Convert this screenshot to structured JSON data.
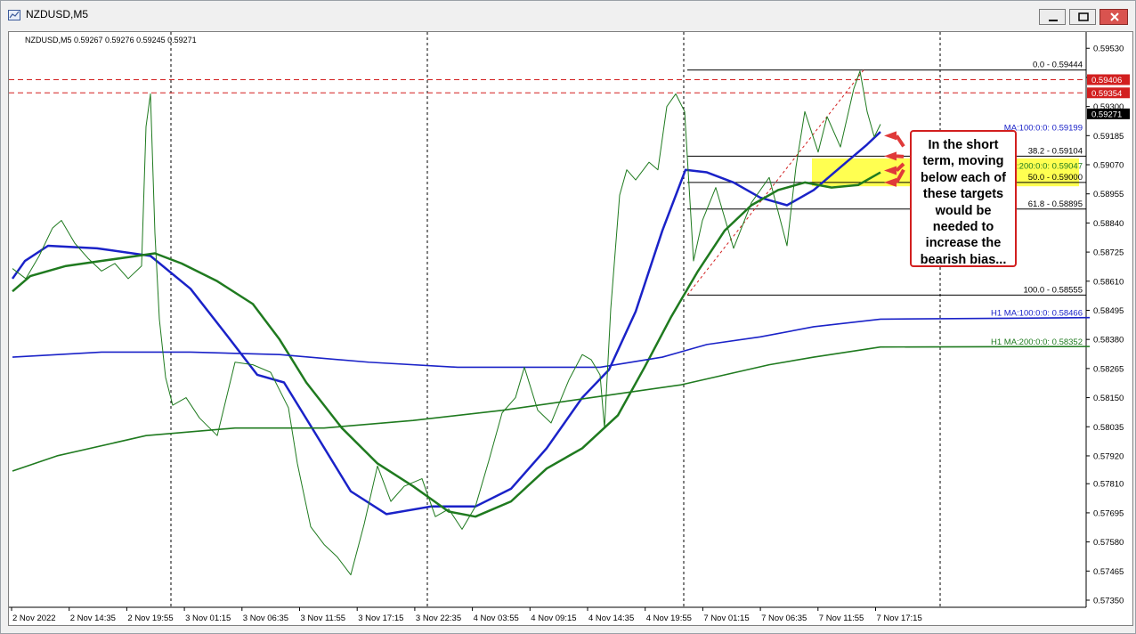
{
  "window": {
    "title": "NZDUSD,M5"
  },
  "chart_data": {
    "type": "line",
    "symbol_header": "NZDUSD,M5  0.59267 0.59276 0.59245 0.59271",
    "y_range": [
      0.5735,
      0.59566
    ],
    "price_axis_labels": [
      "0.59530",
      "0.59415",
      "0.59300",
      "0.59185",
      "0.59070",
      "0.58955",
      "0.58840",
      "0.58725",
      "0.58610",
      "0.58495",
      "0.58380",
      "0.58265",
      "0.58150",
      "0.58035",
      "0.57920",
      "0.57810",
      "0.57695",
      "0.57580",
      "0.57465",
      "0.57350"
    ],
    "time_axis_labels": [
      "2 Nov 2022",
      "2 Nov 14:35",
      "2 Nov 19:55",
      "3 Nov 01:15",
      "3 Nov 06:35",
      "3 Nov 11:55",
      "3 Nov 17:15",
      "3 Nov 22:35",
      "4 Nov 03:55",
      "4 Nov 09:15",
      "4 Nov 14:35",
      "4 Nov 19:55",
      "7 Nov 01:15",
      "7 Nov 06:35",
      "7 Nov 11:55",
      "7 Nov 17:15"
    ],
    "current_price": "0.59271",
    "horizontal_lines": [
      {
        "value": 0.59406,
        "label": "0.59406",
        "color": "#d21f1f"
      },
      {
        "value": 0.59354,
        "label": "0.59354",
        "color": "#d21f1f"
      }
    ],
    "fibonacci": [
      {
        "label": "0.0 - 0.59444",
        "value": 0.59444
      },
      {
        "label": "38.2 - 0.59104",
        "value": 0.59104
      },
      {
        "label": "50.0 - 0.59000",
        "value": 0.59
      },
      {
        "label": "61.8 - 0.58895",
        "value": 0.58895
      },
      {
        "label": "100.0 - 0.58555",
        "value": 0.58555
      }
    ],
    "ma_labels": [
      {
        "label": "MA:100:0:0: 0.59199",
        "value": 0.59199,
        "color": "#1a22c8"
      },
      {
        "label": "MA:200:0:0: 0.59047",
        "value": 0.59047,
        "color": "#1f7a1f"
      },
      {
        "label": "H1 MA:100:0:0: 0.58466",
        "value": 0.58466,
        "color": "#1a22c8"
      },
      {
        "label": "H1 MA:200:0:0: 0.58352",
        "value": 0.58352,
        "color": "#1f7a1f"
      }
    ],
    "series": [
      {
        "name": "MA:100",
        "color": "#1a22c8",
        "x": [
          0,
          14,
          40,
          95,
          155,
          200,
          240,
          275,
          305,
          340,
          380,
          420,
          470,
          520,
          560,
          600,
          640,
          670,
          700,
          730,
          756,
          780,
          810,
          840,
          870,
          900,
          930,
          960,
          975
        ],
        "y": [
          0.5862,
          0.5869,
          0.5875,
          0.5874,
          0.5871,
          0.5858,
          0.584,
          0.5824,
          0.5821,
          0.5801,
          0.5778,
          0.5769,
          0.5772,
          0.5772,
          0.5779,
          0.5795,
          0.5815,
          0.5826,
          0.5849,
          0.5881,
          0.5905,
          0.5904,
          0.59,
          0.5894,
          0.5891,
          0.5897,
          0.5906,
          0.5915,
          0.592
        ]
      },
      {
        "name": "MA:200",
        "color": "#1f7a1f",
        "x": [
          0,
          20,
          60,
          100,
          140,
          160,
          190,
          230,
          270,
          300,
          330,
          370,
          410,
          450,
          490,
          520,
          560,
          600,
          640,
          680,
          710,
          740,
          770,
          800,
          830,
          860,
          890,
          920,
          950,
          975
        ],
        "y": [
          0.5857,
          0.5863,
          0.5867,
          0.5869,
          0.5871,
          0.5872,
          0.5868,
          0.5861,
          0.5852,
          0.5838,
          0.5821,
          0.5803,
          0.5789,
          0.578,
          0.577,
          0.5768,
          0.5774,
          0.5787,
          0.5795,
          0.5808,
          0.5827,
          0.5847,
          0.5865,
          0.5881,
          0.5891,
          0.5897,
          0.59,
          0.5898,
          0.5899,
          0.5904
        ]
      },
      {
        "name": "H1 MA:100",
        "color": "#1a22c8",
        "x": [
          0,
          100,
          200,
          300,
          400,
          500,
          580,
          660,
          730,
          780,
          840,
          900,
          975,
          1210
        ],
        "y": [
          0.5831,
          0.5833,
          0.5833,
          0.5832,
          0.5829,
          0.5827,
          0.5827,
          0.5827,
          0.5831,
          0.5836,
          0.5839,
          0.5843,
          0.5846,
          0.58466
        ]
      },
      {
        "name": "H1 MA:200",
        "color": "#1f7a1f",
        "x": [
          0,
          50,
          150,
          250,
          350,
          450,
          550,
          650,
          750,
          850,
          900,
          975,
          1210
        ],
        "y": [
          0.5786,
          0.5792,
          0.58,
          0.5803,
          0.5803,
          0.5806,
          0.581,
          0.5815,
          0.582,
          0.5828,
          0.5831,
          0.5835,
          0.58352
        ]
      },
      {
        "name": "price",
        "color": "#1f7a1f",
        "x": [
          0,
          15,
          30,
          45,
          55,
          70,
          85,
          100,
          115,
          130,
          145,
          150,
          155,
          160,
          165,
          172,
          180,
          195,
          210,
          230,
          250,
          270,
          290,
          310,
          320,
          335,
          350,
          365,
          380,
          395,
          410,
          425,
          440,
          460,
          475,
          490,
          505,
          520,
          535,
          550,
          565,
          575,
          590,
          605,
          625,
          640,
          650,
          660,
          665,
          672,
          682,
          690,
          700,
          715,
          725,
          735,
          745,
          755,
          765,
          775,
          790,
          810,
          830,
          850,
          870,
          880,
          890,
          905,
          915,
          930,
          945,
          952,
          960,
          968,
          975
        ],
        "y": [
          0.5866,
          0.5862,
          0.5871,
          0.5882,
          0.5885,
          0.5876,
          0.587,
          0.5865,
          0.5868,
          0.5862,
          0.5867,
          0.5922,
          0.5935,
          0.588,
          0.5846,
          0.5823,
          0.5812,
          0.5815,
          0.5807,
          0.58,
          0.5829,
          0.5828,
          0.5825,
          0.5811,
          0.5789,
          0.5764,
          0.5757,
          0.5752,
          0.5745,
          0.5765,
          0.5788,
          0.5774,
          0.578,
          0.5783,
          0.5768,
          0.5771,
          0.5763,
          0.5772,
          0.579,
          0.5809,
          0.5815,
          0.5827,
          0.581,
          0.5805,
          0.5822,
          0.5832,
          0.583,
          0.5824,
          0.5803,
          0.585,
          0.5895,
          0.5905,
          0.5901,
          0.5908,
          0.5905,
          0.593,
          0.5935,
          0.5928,
          0.5869,
          0.5885,
          0.5898,
          0.5874,
          0.5892,
          0.5902,
          0.5875,
          0.5906,
          0.5928,
          0.5912,
          0.5926,
          0.5914,
          0.5937,
          0.5944,
          0.5928,
          0.5918,
          0.5923
        ]
      }
    ],
    "annotation": "In the short term, moving below each of these targets would be needed to increase the bearish bias...",
    "colors": {
      "background": "#ffffff",
      "grid": "#000000",
      "ma100": "#1a22c8",
      "ma200": "#1f7a1f",
      "level": "#d21f1f",
      "highlight": "#ffff33"
    }
  }
}
